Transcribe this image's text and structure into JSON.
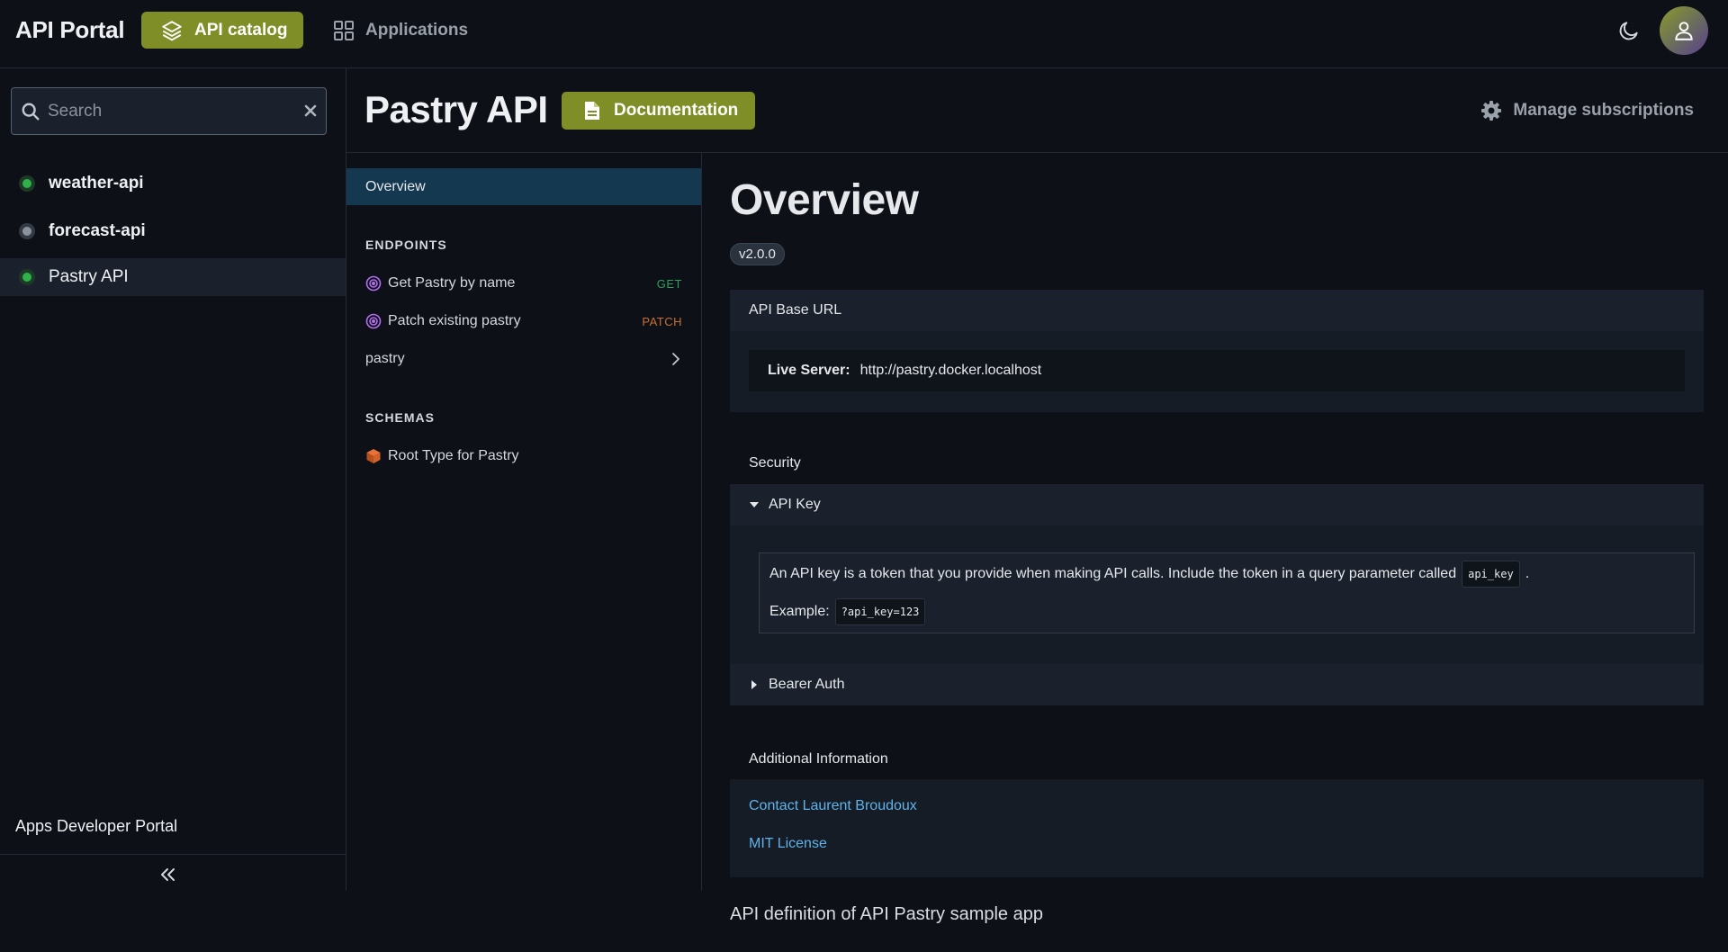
{
  "header": {
    "brand": "API Portal",
    "catalog_label": "API catalog",
    "applications_label": "Applications",
    "accent_color": "#7f8e27"
  },
  "sidebar": {
    "search_placeholder": "Search",
    "items": [
      {
        "label": "weather-api",
        "status": "green"
      },
      {
        "label": "forecast-api",
        "status": "gray"
      },
      {
        "label": "Pastry API",
        "status": "green",
        "active": true
      }
    ],
    "footer": "Apps Developer Portal"
  },
  "api": {
    "title": "Pastry API",
    "documentation_label": "Documentation",
    "manage_label": "Manage subscriptions"
  },
  "nav": {
    "overview": "Overview",
    "endpoints_heading": "ENDPOINTS",
    "endpoints": [
      {
        "label": "Get Pastry by name",
        "method": "GET"
      },
      {
        "label": "Patch existing pastry",
        "method": "PATCH"
      }
    ],
    "group_label": "pastry",
    "schemas_heading": "SCHEMAS",
    "schemas": [
      {
        "label": "Root Type for Pastry"
      }
    ]
  },
  "content": {
    "title": "Overview",
    "version": "v2.0.0",
    "base_url_heading": "API Base URL",
    "server_label": "Live Server:",
    "server_url": "http://pastry.docker.localhost",
    "security_heading": "Security",
    "api_key_label": "API Key",
    "api_key_text": "An API key is a token that you provide when making API calls. Include the token in a query parameter called",
    "api_key_param": "api_key",
    "api_key_after": ".",
    "example_label": "Example:",
    "example_value": "?api_key=123",
    "bearer_label": "Bearer Auth",
    "additional_heading": "Additional Information",
    "contact_link": "Contact Laurent Broudoux",
    "license_link": "MIT License",
    "description": "API definition of API Pastry sample app"
  }
}
